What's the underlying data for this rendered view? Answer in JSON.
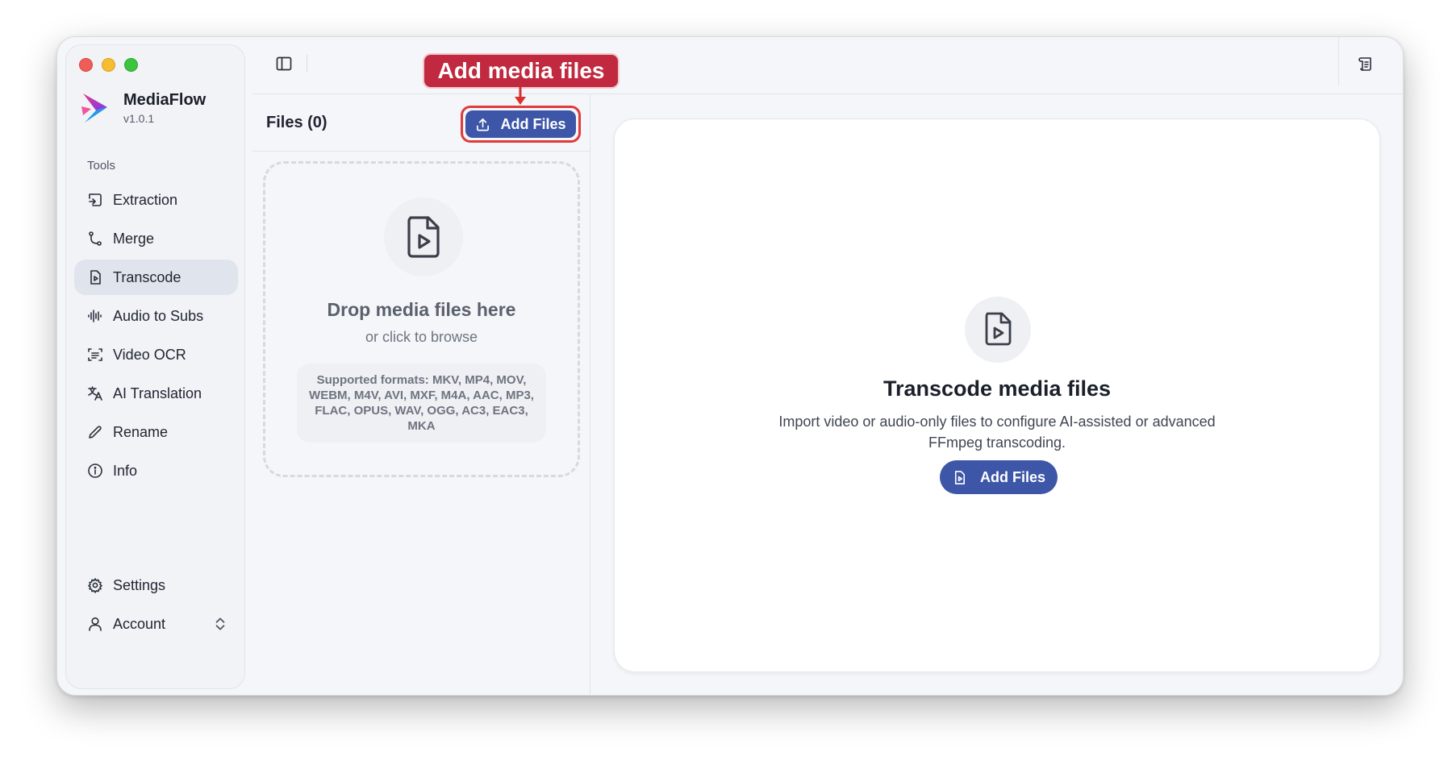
{
  "app": {
    "name": "MediaFlow",
    "version": "v1.0.1"
  },
  "sidebar": {
    "section_label": "Tools",
    "items": [
      {
        "label": "Extraction",
        "icon": "extraction-icon"
      },
      {
        "label": "Merge",
        "icon": "merge-icon"
      },
      {
        "label": "Transcode",
        "icon": "transcode-icon",
        "active": true
      },
      {
        "label": "Audio to Subs",
        "icon": "audio-wave-icon"
      },
      {
        "label": "Video OCR",
        "icon": "ocr-scan-icon"
      },
      {
        "label": "AI Translation",
        "icon": "translate-icon"
      },
      {
        "label": "Rename",
        "icon": "pencil-icon"
      },
      {
        "label": "Info",
        "icon": "info-icon"
      }
    ],
    "bottom_items": [
      {
        "label": "Settings",
        "icon": "gear-icon"
      },
      {
        "label": "Account",
        "icon": "user-icon"
      }
    ]
  },
  "header": {
    "left_icon": "sidebar-toggle-icon",
    "right_icon": "log-icon"
  },
  "files_panel": {
    "title": "Files (0)",
    "add_button_label": "Add Files",
    "dropzone": {
      "title": "Drop media files here",
      "subtitle": "or click to browse",
      "formats": "Supported formats: MKV, MP4, MOV, WEBM, M4V, AVI, MXF, M4A, AAC, MP3, FLAC, OPUS, WAV, OGG, AC3, EAC3, MKA"
    }
  },
  "main": {
    "title": "Transcode media files",
    "description": "Import video or audio-only files to configure AI-assisted or advanced FFmpeg transcoding.",
    "button_label": "Add Files"
  },
  "annotation": {
    "text": "Add media files"
  },
  "colors": {
    "accent": "#3d56a8",
    "annotation": "#c0293f",
    "highlight_border": "#e03a3a",
    "traffic_red": "#ee5e57",
    "traffic_yellow": "#f5bd2f",
    "traffic_green": "#3cc43f"
  }
}
